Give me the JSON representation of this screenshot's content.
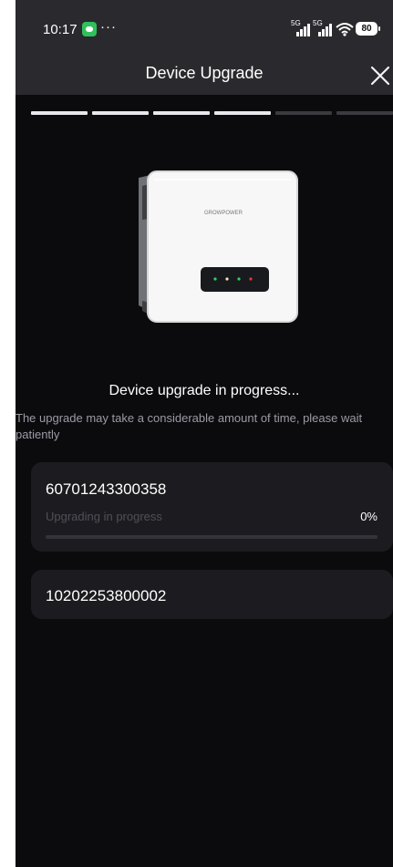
{
  "status_bar": {
    "time": "10:17",
    "more": "···",
    "network_1": "5G",
    "network_2": "5G",
    "battery": "80"
  },
  "header": {
    "title": "Device Upgrade",
    "close_icon": "close-icon"
  },
  "stepper": {
    "total": 6,
    "completed": 4,
    "active_color": "#e8e8ec",
    "inactive_color": "#3a3a3f"
  },
  "device_image": {
    "brand_mark": "GROWPOWER",
    "icon": "inverter-device-image"
  },
  "progress": {
    "title": "Device upgrade in progress...",
    "note": "The upgrade may take a considerable amount of time, please wait patiently"
  },
  "devices": [
    {
      "serial": "60701243300358",
      "status": "Upgrading in progress",
      "percent_label": "0%",
      "progress": 0
    },
    {
      "serial": "10202253800002"
    }
  ],
  "colors": {
    "background": "#0b0b0e",
    "header": "#2a2a2e",
    "card": "#1c1c20",
    "accent": "#2fc15b"
  }
}
